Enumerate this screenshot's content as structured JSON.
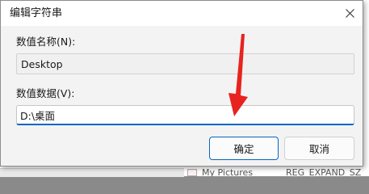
{
  "dialog": {
    "title": "编辑字符串",
    "close_label": "×"
  },
  "fields": {
    "name_label": "数值名称(N):",
    "name_value": "Desktop",
    "data_label": "数值数据(V):",
    "data_value": "D:\\桌面"
  },
  "buttons": {
    "ok": "确定",
    "cancel": "取消"
  },
  "background": {
    "row_name": "My Pictures",
    "row_type": "REG_EXPAND_SZ"
  },
  "colors": {
    "accent": "#0067c0",
    "annotation_arrow": "#e8231f"
  }
}
